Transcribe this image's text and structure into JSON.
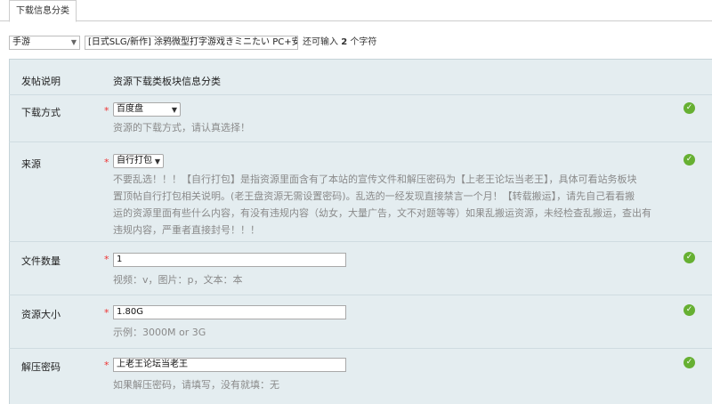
{
  "tab": {
    "label": "下载信息分类"
  },
  "post": {
    "category": "手游",
    "subject": "[日式SLG/新作] 涂鸦微型打字游戏きミニたい PC+安卓 全",
    "remain_prefix": "还可输入",
    "remain_count": "2",
    "remain_suffix": "个字符"
  },
  "section": {
    "label": "发帖说明",
    "value": "资源下载类板块信息分类"
  },
  "fields": {
    "download": {
      "label": "下载方式",
      "required": "*",
      "value": "百度盘",
      "hint": "资源的下载方式，请认真选择！"
    },
    "source": {
      "label": "来源",
      "required": "*",
      "value": "自行打包",
      "hint_lines": [
        "不要乱选！！！【自行打包】是指资源里面含有了本站的宣传文件和解压密码为【上老王论坛当老王】，具体可看站务板块",
        "置顶帖自行打包相关说明。(老王盘资源无需设置密码)。乱选的一经发现直接禁言一个月！【转载搬运】，请先自己看看搬",
        "运的资源里面有些什么内容，有没有违规内容（幼女，大量广告，文不对题等等）如果乱搬运资源，未经检查乱搬运，查出有",
        "违规内容，严重者直接封号！！！"
      ]
    },
    "file_count": {
      "label": "文件数量",
      "required": "*",
      "value": "1",
      "hint": "视频：v，图片：p，文本：本"
    },
    "size": {
      "label": "资源大小",
      "required": "*",
      "value": "1.80G",
      "hint": "示例：3000M or 3G"
    },
    "password": {
      "label": "解压密码",
      "required": "*",
      "value": "上老王论坛当老王",
      "hint": "如果解压密码，请填写，没有就填：无"
    }
  },
  "icons": {
    "dropdown": "chevron-down-icon",
    "valid": "check-circle-icon"
  },
  "colors": {
    "panel_bg": "#e4edf0",
    "required": "#ee3333",
    "valid": "#66b032"
  }
}
